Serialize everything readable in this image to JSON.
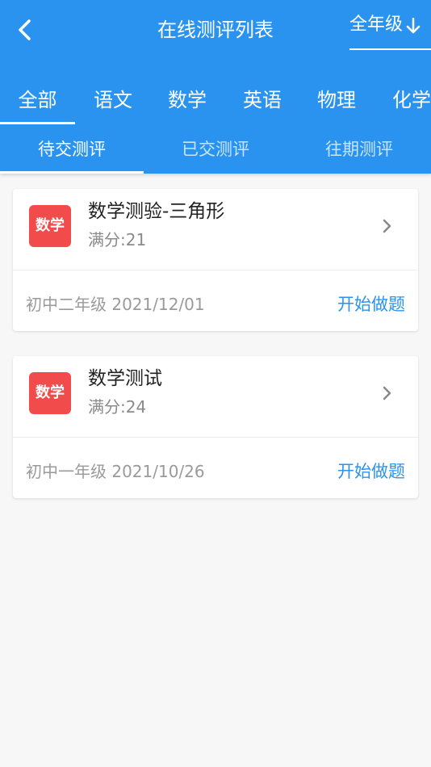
{
  "header": {
    "title": "在线测评列表",
    "grade_filter": "全年级",
    "accent_color": "#2a93f0"
  },
  "subject_tabs": [
    {
      "label": "全部",
      "active": true
    },
    {
      "label": "语文"
    },
    {
      "label": "数学"
    },
    {
      "label": "英语"
    },
    {
      "label": "物理"
    },
    {
      "label": "化学"
    }
  ],
  "status_tabs": [
    {
      "label": "待交测评",
      "active": true
    },
    {
      "label": "已交测评"
    },
    {
      "label": "往期测评"
    }
  ],
  "tests": [
    {
      "subject": "数学",
      "title": "数学测验-三角形",
      "score": "满分:21",
      "grade_date": "初中二年级 2021/12/01",
      "action": "开始做题"
    },
    {
      "subject": "数学",
      "title": "数学测试",
      "score": "满分:24",
      "grade_date": "初中一年级 2021/10/26",
      "action": "开始做题"
    }
  ],
  "icons": {
    "back": "chevron-left-icon",
    "grade_arrow": "arrow-down-icon",
    "card_arrow": "chevron-right-icon"
  }
}
